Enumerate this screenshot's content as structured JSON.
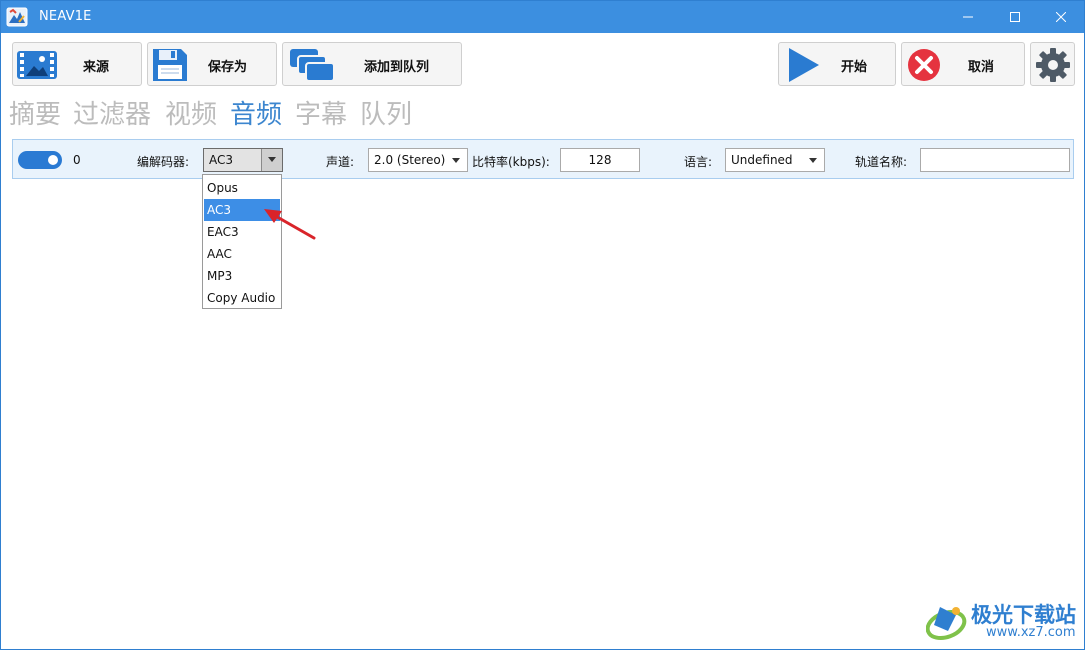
{
  "window": {
    "title": "NEAV1E",
    "controls": [
      "minimize-icon",
      "maximize-icon",
      "close-icon"
    ]
  },
  "toolbar": {
    "source_label": "来源",
    "save_as_label": "保存为",
    "add_to_queue_label": "添加到队列",
    "start_label": "开始",
    "cancel_label": "取消"
  },
  "tabs": [
    {
      "label": "摘要",
      "active": false
    },
    {
      "label": "过滤器",
      "active": false
    },
    {
      "label": "视频",
      "active": false
    },
    {
      "label": "音频",
      "active": true
    },
    {
      "label": "字幕",
      "active": false
    },
    {
      "label": "队列",
      "active": false
    }
  ],
  "audio_track": {
    "enabled": true,
    "index": "0",
    "codec_label": "编解码器:",
    "codec_value": "AC3",
    "channels_label": "声道:",
    "channels_value": "2.0 (Stereo)",
    "bitrate_label": "比特率(kbps):",
    "bitrate_value": "128",
    "language_label": "语言:",
    "language_value": "Undefined",
    "track_name_label": "轨道名称:",
    "track_name_value": ""
  },
  "codec_dropdown": {
    "options": [
      "Opus",
      "AC3",
      "EAC3",
      "AAC",
      "MP3",
      "Copy Audio"
    ],
    "selected": "AC3"
  },
  "watermark": {
    "name": "极光下载站",
    "url": "www.xz7.com"
  },
  "colors": {
    "titlebar": "#3c8fe0",
    "active_tab": "#3c86cf",
    "inactive_tab": "#bcbcbc",
    "selection": "#3d8ee6",
    "track_bg": "#e9f3fc",
    "annotation_arrow": "#d9242a"
  }
}
